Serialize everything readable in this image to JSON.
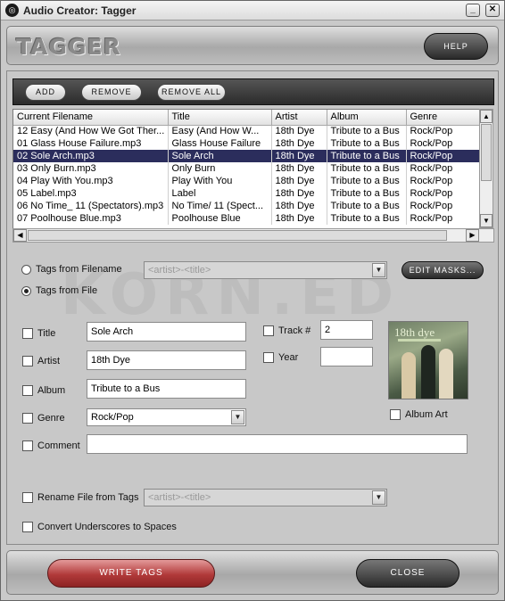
{
  "window": {
    "title": "Audio Creator: Tagger",
    "app_icon": "audio-creator-icon",
    "minimize_glyph": "_",
    "close_glyph": "✕"
  },
  "header": {
    "logo_text": "TAGGER",
    "help_label": "HELP"
  },
  "toolbar": {
    "add_label": "ADD",
    "remove_label": "REMOVE",
    "remove_all_label": "REMOVE ALL"
  },
  "file_list": {
    "columns": [
      "Current Filename",
      "Title",
      "Artist",
      "Album",
      "Genre"
    ],
    "rows": [
      [
        "12 Easy (And How We Got Ther...",
        "Easy (And How W...",
        "18th Dye",
        "Tribute to a Bus",
        "Rock/Pop"
      ],
      [
        "01 Glass House Failure.mp3",
        "Glass House Failure",
        "18th Dye",
        "Tribute to a Bus",
        "Rock/Pop"
      ],
      [
        "02 Sole Arch.mp3",
        "Sole Arch",
        "18th Dye",
        "Tribute to a Bus",
        "Rock/Pop"
      ],
      [
        "03 Only Burn.mp3",
        "Only Burn",
        "18th Dye",
        "Tribute to a Bus",
        "Rock/Pop"
      ],
      [
        "04 Play With You.mp3",
        "Play With You",
        "18th Dye",
        "Tribute to a Bus",
        "Rock/Pop"
      ],
      [
        "05 Label.mp3",
        "Label",
        "18th Dye",
        "Tribute to a Bus",
        "Rock/Pop"
      ],
      [
        "06 No Time_ 11 (Spectators).mp3",
        "No Time/ 11 (Spect...",
        "18th Dye",
        "Tribute to a Bus",
        "Rock/Pop"
      ],
      [
        "07 Poolhouse Blue.mp3",
        "Poolhouse Blue",
        "18th Dye",
        "Tribute to a Bus",
        "Rock/Pop"
      ]
    ],
    "selected_row": 2
  },
  "source": {
    "from_filename_label": "Tags from Filename",
    "from_file_label": "Tags from File",
    "selected": "from_file",
    "mask_value": "<artist>-<title>",
    "edit_masks_label": "EDIT MASKS..."
  },
  "watermark": "KORN.ED",
  "tags": {
    "title_label": "Title",
    "title_value": "Sole Arch",
    "artist_label": "Artist",
    "artist_value": "18th Dye",
    "album_label": "Album",
    "album_value": "Tribute to a Bus",
    "genre_label": "Genre",
    "genre_value": "Rock/Pop",
    "comment_label": "Comment",
    "comment_value": "",
    "track_label": "Track #",
    "track_value": "2",
    "year_label": "Year",
    "year_value": "",
    "album_art_label": "Album Art",
    "album_art_text": "18th dye"
  },
  "options": {
    "rename_label": "Rename File from Tags",
    "rename_mask": "<artist>-<title>",
    "underscores_label": "Convert Underscores to Spaces"
  },
  "footer": {
    "write_label": "WRITE TAGS",
    "close_label": "CLOSE"
  },
  "colors": {
    "selection": "#2b2d5c",
    "write_button": "#b13a3a",
    "dark_button": "#2a2a2a"
  }
}
